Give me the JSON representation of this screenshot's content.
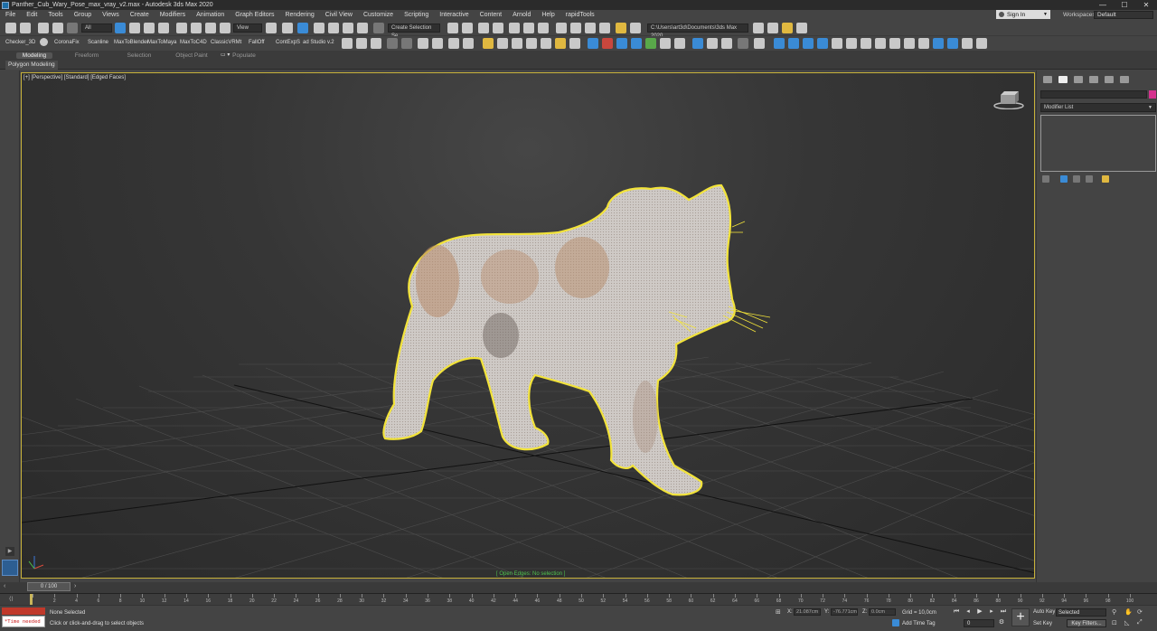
{
  "window": {
    "title": "Panther_Cub_Wary_Pose_max_vray_v2.max - Autodesk 3ds Max 2020",
    "minimize": "—",
    "maximize": "☐",
    "close": "✕"
  },
  "menu": [
    "File",
    "Edit",
    "Tools",
    "Group",
    "Views",
    "Create",
    "Modifiers",
    "Animation",
    "Graph Editors",
    "Rendering",
    "Civil View",
    "Customize",
    "Scripting",
    "Interactive",
    "Content",
    "Arnold",
    "Help",
    "rapidTools"
  ],
  "account": {
    "signin": "Sign In",
    "workspaces_label": "Workspaces:",
    "workspace": "Default"
  },
  "toolbar": {
    "filter": "All",
    "ref_coord": "View",
    "selection_set": "Create Selection Se",
    "project_path": "C:\\Users\\art3d\\Documents\\3ds Max 2020"
  },
  "plugins": [
    "Checker_3D",
    "CoronaFix",
    "Scanline",
    "MaxToBlender",
    "MaxToMaya",
    "MaxToC4D",
    "ClassicVRMt",
    "FallOff",
    "ContExpS",
    "ad Studio v.2"
  ],
  "ribbon": {
    "tabs": [
      "Modeling",
      "Freeform",
      "Selection",
      "Object Paint",
      "Populate"
    ],
    "active_tab": "Modeling",
    "panel": "Polygon Modeling"
  },
  "viewport": {
    "label": "[+] [Perspective] [Standard] [Edged Faces]",
    "status": "[ Open Edges: No selection ]"
  },
  "command_panel": {
    "modifier_list": "Modifier List"
  },
  "timeline": {
    "slider": "0 / 100",
    "ticks": [
      0,
      2,
      4,
      6,
      8,
      10,
      12,
      14,
      16,
      18,
      20,
      22,
      24,
      26,
      28,
      30,
      32,
      34,
      36,
      38,
      40,
      42,
      44,
      46,
      48,
      50,
      52,
      54,
      56,
      58,
      60,
      62,
      64,
      66,
      68,
      70,
      72,
      74,
      76,
      78,
      80,
      82,
      84,
      86,
      88,
      90,
      92,
      94,
      96,
      98,
      100
    ]
  },
  "status": {
    "maxscript": "*Time needed",
    "selection": "None Selected",
    "prompt": "Click or click-and-drag to select objects",
    "x_label": "X:",
    "x_value": "21.087cm",
    "y_label": "Y:",
    "y_value": "-76.771cm",
    "z_label": "Z:",
    "z_value": "0.0cm",
    "grid": "Grid = 10,0cm",
    "add_time_tag": "Add Time Tag",
    "auto_key": "Auto Key",
    "set_key": "Set Key",
    "selected": "Selected",
    "key_filters": "Key Filters...",
    "frame": "0"
  }
}
